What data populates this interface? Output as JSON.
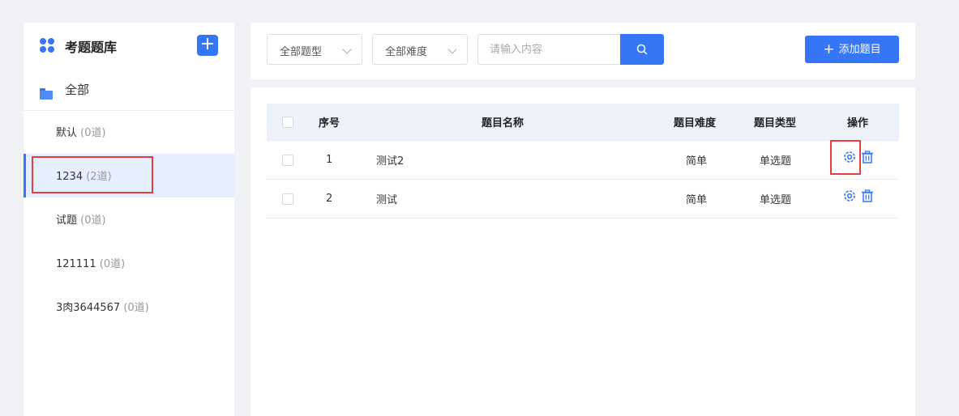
{
  "sidebar": {
    "title": "考题题库",
    "add_icon": "plus-icon",
    "all_label": "全部",
    "items": [
      {
        "label": "默认",
        "count": "(0道)"
      },
      {
        "label": "1234",
        "count": "(2道)",
        "active": true
      },
      {
        "label": "试题",
        "count": "(0道)"
      },
      {
        "label": "121111",
        "count": "(0道)"
      },
      {
        "label": "3肉3644567",
        "count": "(0道)"
      }
    ]
  },
  "toolbar": {
    "type_select": "全部题型",
    "difficulty_select": "全部难度",
    "search_placeholder": "请输入内容",
    "add_button": "添加题目"
  },
  "table": {
    "headers": {
      "index": "序号",
      "name": "题目名称",
      "difficulty": "题目难度",
      "type": "题目类型",
      "actions": "操作"
    },
    "rows": [
      {
        "index": "1",
        "name": "测试2",
        "difficulty": "简单",
        "type": "单选题"
      },
      {
        "index": "2",
        "name": "测试",
        "difficulty": "简单",
        "type": "单选题"
      }
    ]
  },
  "colors": {
    "accent": "#3476f5",
    "highlight": "#e53e3e"
  }
}
